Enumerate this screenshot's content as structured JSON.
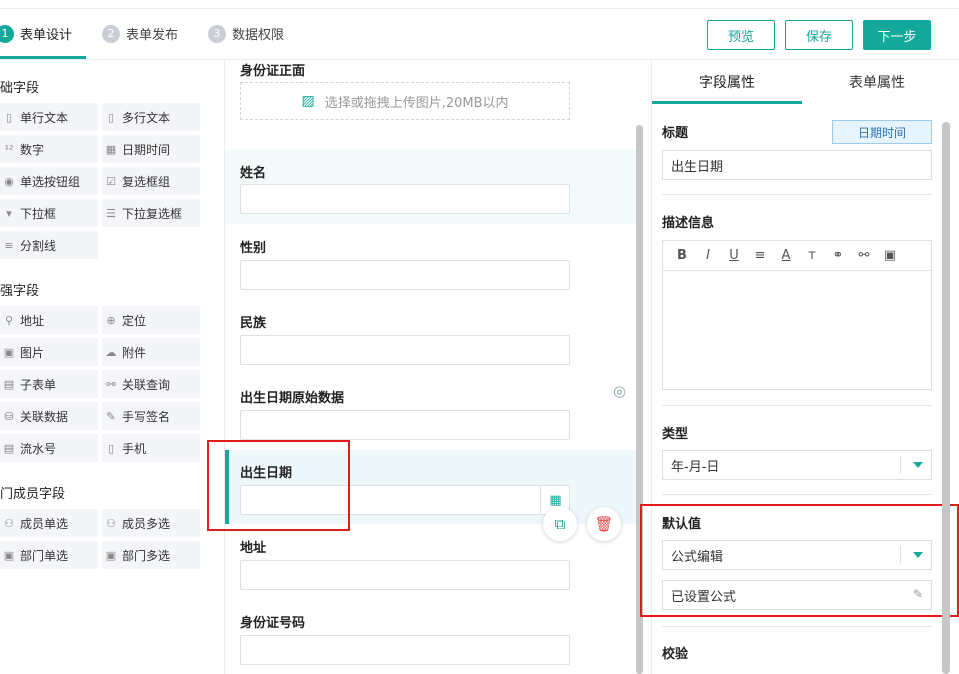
{
  "steps": [
    {
      "num": "1",
      "label": "表单设计"
    },
    {
      "num": "2",
      "label": "表单发布"
    },
    {
      "num": "3",
      "label": "数据权限"
    }
  ],
  "toolbar": {
    "preview": "预览",
    "save": "保存",
    "next": "下一步"
  },
  "left": {
    "groups": [
      {
        "title": "础字段",
        "items": [
          "单行文本",
          "多行文本",
          "数字",
          "日期时间",
          "单选按钮组",
          "复选框组",
          "下拉框",
          "下拉复选框",
          "分割线"
        ]
      },
      {
        "title": "强字段",
        "items": [
          "地址",
          "定位",
          "图片",
          "附件",
          "子表单",
          "关联查询",
          "关联数据",
          "手写签名",
          "流水号",
          "手机"
        ]
      },
      {
        "title": "门成员字段",
        "items": [
          "成员单选",
          "成员多选",
          "部门单选",
          "部门多选"
        ]
      }
    ]
  },
  "canvas": {
    "id_front_label": "身份证正面",
    "upload_hint": "选择或拖拽上传图片,20MB以内",
    "fields": [
      "姓名",
      "性别",
      "民族",
      "出生日期原始数据",
      "出生日期",
      "地址",
      "身份证号码"
    ]
  },
  "right": {
    "tabs": [
      "字段属性",
      "表单属性"
    ],
    "title_label": "标题",
    "title_tag": "日期时间",
    "title_value": "出生日期",
    "desc_label": "描述信息",
    "editor_tools": [
      "B",
      "I",
      "U",
      "≡",
      "A",
      "т",
      "⚭",
      "⚯",
      "▣"
    ],
    "type_label": "类型",
    "type_value": "年-月-日",
    "default_label": "默认值",
    "default_mode": "公式编辑",
    "formula_status": "已设置公式",
    "validate_label": "校验"
  }
}
